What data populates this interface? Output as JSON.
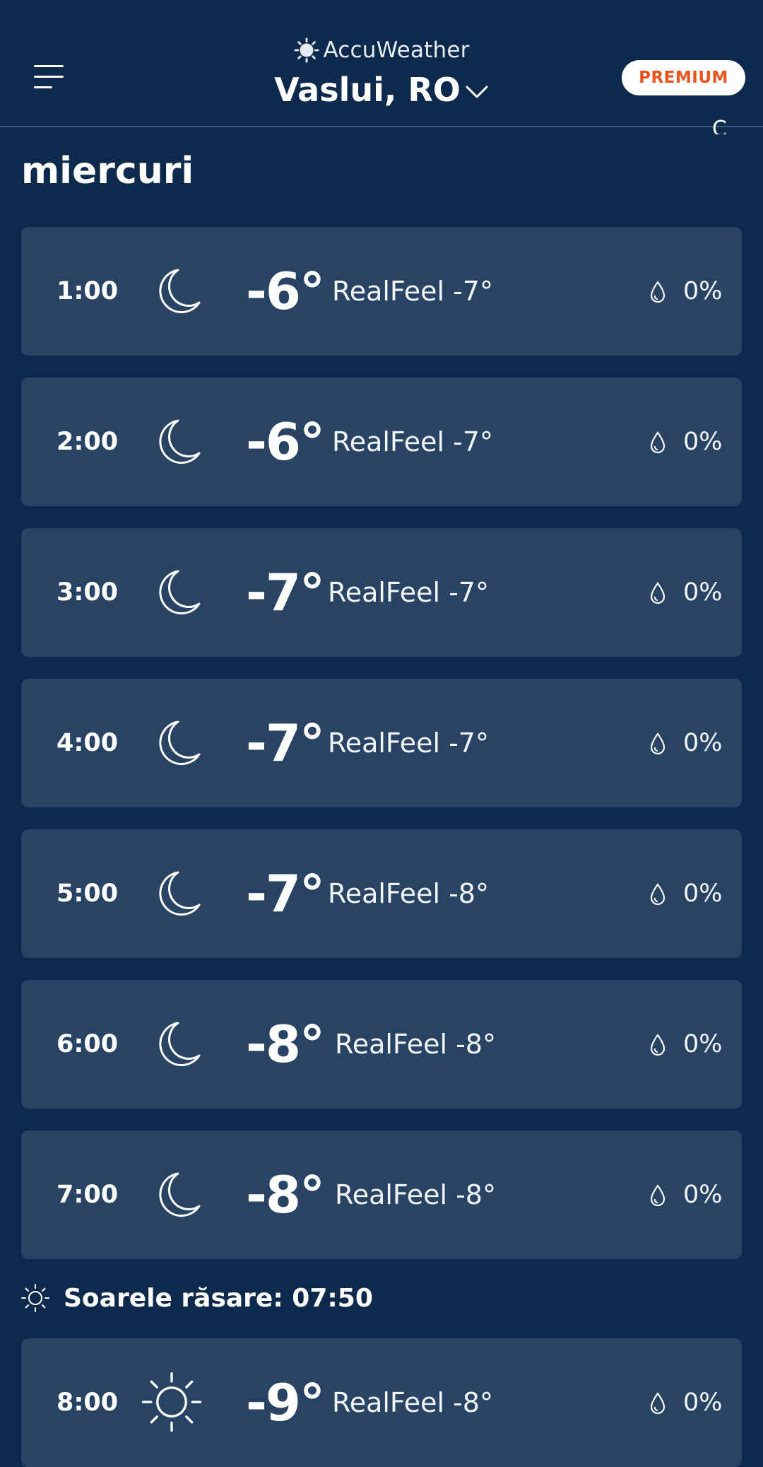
{
  "header": {
    "brand": "AccuWeather",
    "location": "Vaslui, RO",
    "premium_label": "PREMIUM"
  },
  "partial_unit": "C",
  "day_title": "miercuri",
  "hours": [
    {
      "time": "1:00",
      "icon": "moon-icon",
      "temp": "-6°",
      "realfeel": "RealFeel -7°",
      "precip": "0%"
    },
    {
      "time": "2:00",
      "icon": "moon-icon",
      "temp": "-6°",
      "realfeel": "RealFeel -7°",
      "precip": "0%"
    },
    {
      "time": "3:00",
      "icon": "moon-icon",
      "temp": "-7°",
      "realfeel": "RealFeel -7°",
      "precip": "0%"
    },
    {
      "time": "4:00",
      "icon": "moon-icon",
      "temp": "-7°",
      "realfeel": "RealFeel -7°",
      "precip": "0%"
    },
    {
      "time": "5:00",
      "icon": "moon-icon",
      "temp": "-7°",
      "realfeel": "RealFeel -8°",
      "precip": "0%"
    },
    {
      "time": "6:00",
      "icon": "moon-icon",
      "temp": "-8°",
      "realfeel": "RealFeel -8°",
      "precip": "0%"
    },
    {
      "time": "7:00",
      "icon": "moon-icon",
      "temp": "-8°",
      "realfeel": "RealFeel -8°",
      "precip": "0%"
    },
    {
      "time": "8:00",
      "icon": "sun-icon",
      "temp": "-9°",
      "realfeel": "RealFeel -8°",
      "precip": "0%"
    }
  ],
  "sunrise": {
    "label": "Soarele răsare: 07:50",
    "icon": "sunrise-icon"
  },
  "colors": {
    "background": "#0d2a4c",
    "card": "#284363",
    "premium_text": "#e9541d"
  }
}
